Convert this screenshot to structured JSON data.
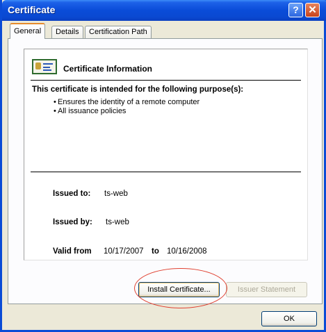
{
  "window": {
    "title": "Certificate"
  },
  "titlebar_buttons": {
    "help": "?",
    "close": "✕"
  },
  "tabs": [
    {
      "label": "General",
      "active": true
    },
    {
      "label": "Details",
      "active": false
    },
    {
      "label": "Certification Path",
      "active": false
    }
  ],
  "certificate": {
    "heading": "Certificate Information",
    "purpose_title": "This certificate is intended for the following purpose(s):",
    "purposes": [
      "Ensures the identity of a remote computer",
      "All issuance policies"
    ],
    "issued_to_label": "Issued to:",
    "issued_to": "ts-web",
    "issued_by_label": "Issued by:",
    "issued_by": "ts-web",
    "valid_from_label": "Valid from",
    "valid_from": "10/17/2007",
    "valid_to_label": "to",
    "valid_to": "10/16/2008"
  },
  "buttons": {
    "install": "Install Certificate...",
    "issuer_statement": "Issuer Statement",
    "ok": "OK"
  },
  "colors": {
    "titlebar": "#0a4cd8",
    "tab_accent": "#e68b2c",
    "highlight": "#e04030"
  }
}
